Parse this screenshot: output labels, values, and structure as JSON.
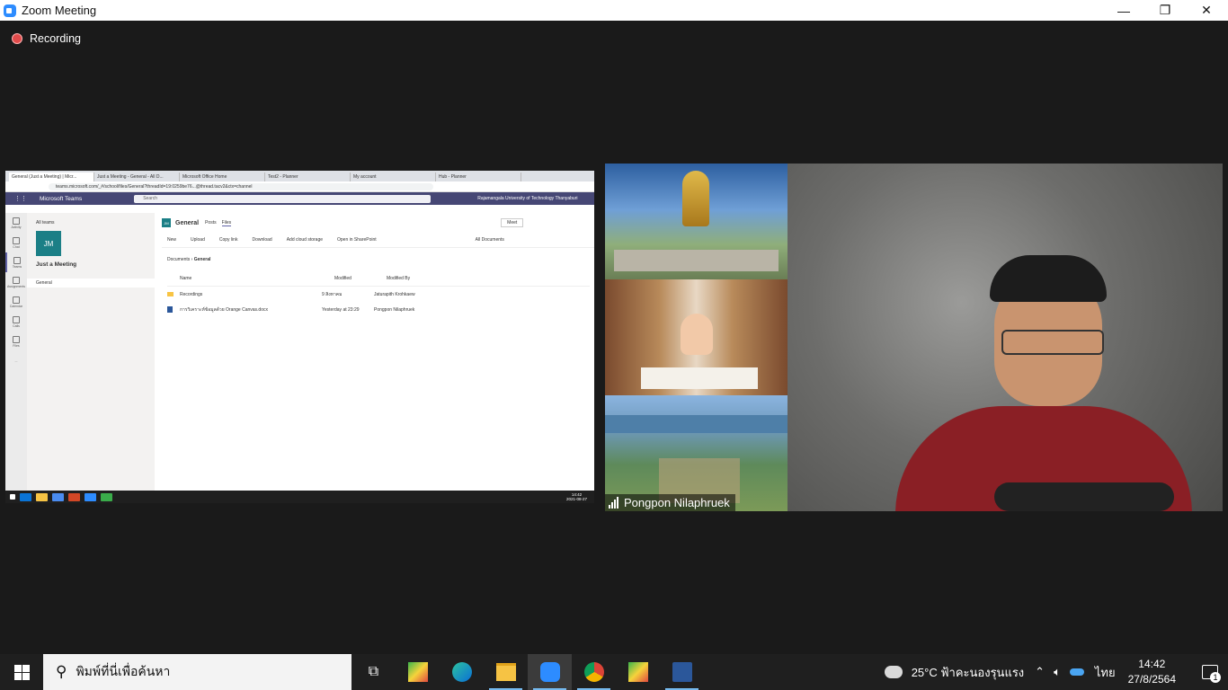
{
  "window": {
    "title": "Zoom Meeting",
    "minimize": "—",
    "restore": "❐",
    "close": "✕"
  },
  "recording": {
    "label": "Recording"
  },
  "shared_screen": {
    "browser_tabs": [
      "General (Just a Meeting) | Micr...",
      "Just a Meeting - General - All D...",
      "Microsoft Office Home",
      "Test2 - Planner",
      "My account",
      "Hub - Planner"
    ],
    "address": "teams.microsoft.com/_#/school/files/General?threadId=19:0259be76...@thread.tacv2&ctx=channel",
    "teams": {
      "app_name": "Microsoft Teams",
      "search_placeholder": "Search",
      "org": "Rajamangala University of Technology Thanyaburi",
      "rail": [
        "Activity",
        "Chat",
        "Teams",
        "Assignments",
        "Calendar",
        "Calls",
        "Files",
        "...",
        "Apps",
        "Help"
      ],
      "all_teams": "All teams",
      "team_initials": "JM",
      "team_name": "Just a Meeting",
      "channel": "General",
      "channel_header": "General",
      "tabs": [
        "Posts",
        "Files"
      ],
      "meet_button": "Meet",
      "toolbar": [
        "New",
        "Upload",
        "Copy link",
        "Download",
        "Add cloud storage",
        "Open in SharePoint"
      ],
      "view": "All Documents",
      "breadcrumb": [
        "Documents",
        "General"
      ],
      "columns": [
        "Name",
        "Modified",
        "Modified By"
      ],
      "files": [
        {
          "name": "Recordings",
          "modified": "9 สิงหาคม",
          "by": "Jaturapith Krohkaew"
        },
        {
          "name": "การวิเคราะห์ข้อมูลด้วย Orange Canvas.docx",
          "modified": "Yesterday at 23:29",
          "by": "Pongpon Nilaphruek"
        }
      ],
      "taskbar_time": "14:42",
      "taskbar_date": "2021-08-27"
    }
  },
  "participant": {
    "name": "Pongpon Nilaphruek"
  },
  "taskbar": {
    "search_placeholder": "พิมพ์ที่นี่เพื่อค้นหา",
    "weather": "25°C  ฟ้าคะนองรุนแรง",
    "language": "ไทย",
    "time": "14:42",
    "date": "27/8/2564",
    "notification_count": "1"
  },
  "colors": {
    "teams_purple": "#464775",
    "zoom_blue": "#2d8cff",
    "recording_red": "#e14b4b",
    "taskbar": "#1f1f1f"
  }
}
